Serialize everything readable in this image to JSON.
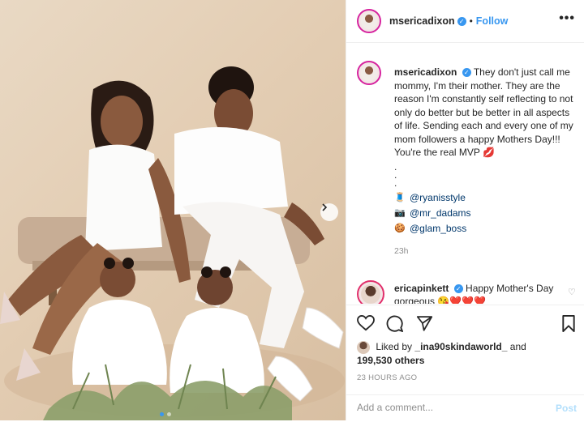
{
  "post": {
    "username": "msericadixon",
    "follow_label": "Follow",
    "more_label": "•••"
  },
  "caption": {
    "username": "msericadixon",
    "text": "They don't just call me mommy, I'm their mother. They are the reason I'm constantly self reflecting to not only do better but be better in all aspects of life. Sending each and every one of my mom followers a happy Mothers Day!!! You're the real MVP 💋",
    "dots": [
      ".",
      ".",
      "."
    ],
    "tags": [
      {
        "emoji": "🧵",
        "handle": "@ryanisstyle"
      },
      {
        "emoji": "📷",
        "handle": "@mr_dadams"
      },
      {
        "emoji": "🍪",
        "handle": "@glam_boss"
      }
    ],
    "time": "23h"
  },
  "comment": {
    "username": "ericapinkett",
    "text": "Happy Mother's Day gorgeous 😘❤️❤️❤️"
  },
  "likes": {
    "prefix": "Liked by",
    "first_user": "_ina90skindaworld_",
    "joiner": "and",
    "count": "199,530 others"
  },
  "posted_time": "23 HOURS AGO",
  "add_comment": {
    "placeholder": "Add a comment...",
    "post_label": "Post"
  },
  "colors": {
    "link_blue": "#3897f0",
    "tag_blue": "#00376b",
    "muted": "#8e8e8e"
  }
}
